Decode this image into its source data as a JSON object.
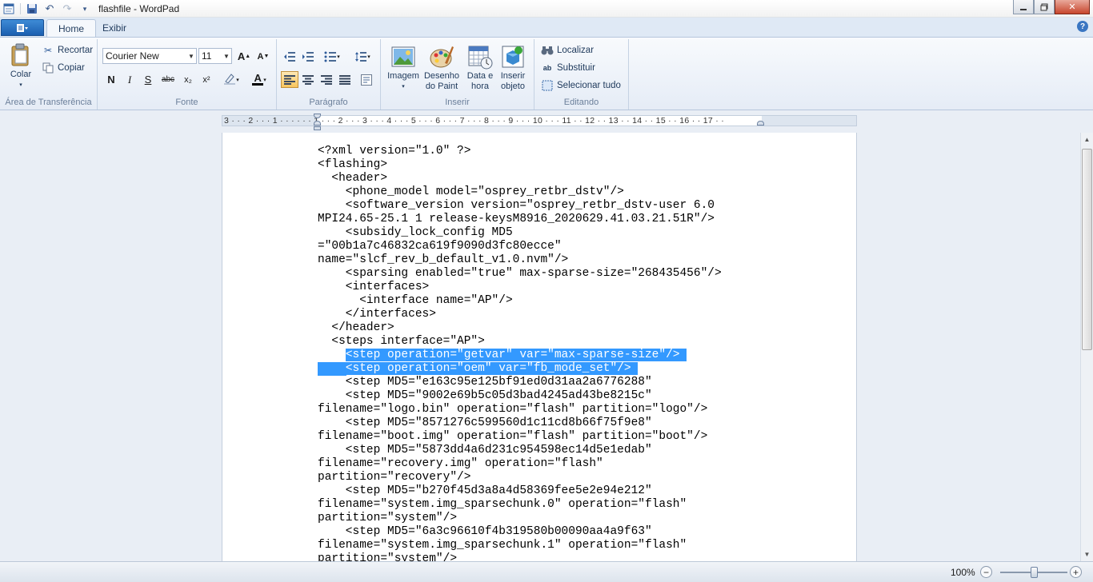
{
  "window": {
    "title": "flashfile - WordPad"
  },
  "tabs": {
    "home": "Home",
    "view": "Exibir"
  },
  "ribbon": {
    "clipboard": {
      "label": "Área de Transferência",
      "paste": "Colar",
      "cut": "Recortar",
      "copy": "Copiar"
    },
    "font": {
      "label": "Fonte",
      "family": "Courier New",
      "size": "11",
      "bold": "N",
      "italic": "I",
      "underline": "S",
      "strike": "abc",
      "subscript": "x₂",
      "superscript": "x²"
    },
    "paragraph": {
      "label": "Parágrafo"
    },
    "insert": {
      "label": "Inserir",
      "image": "Imagem",
      "paint_line1": "Desenho",
      "paint_line2": "do Paint",
      "date_line1": "Data e",
      "date_line2": "hora",
      "object_line1": "Inserir",
      "object_line2": "objeto"
    },
    "editing": {
      "label": "Editando",
      "find": "Localizar",
      "replace": "Substituir",
      "select_all": "Selecionar tudo"
    }
  },
  "ruler": {
    "numbers": "3 · · · 2 · · · 1 · · ·   · · · 1 · · · 2 · · · 3 · · · 4 · · · 5 · · · 6 · · · 7 · · · 8 · · · 9 · · · 10 · · · 11 · · 12 · · 13 · · 14 · · 15 · · 16 · · 17 · ·"
  },
  "document": {
    "lines": [
      "<?xml version=\"1.0\" ?>",
      "<flashing>",
      "  <header>",
      "    <phone_model model=\"osprey_retbr_dstv\"/>",
      "    <software_version version=\"osprey_retbr_dstv-user 6.0",
      "MPI24.65-25.1 1 release-keysM8916_2020629.41.03.21.51R\"/>",
      "    <subsidy_lock_config MD5",
      "=\"00b1a7c46832ca619f9090d3fc80ecce\"",
      "name=\"slcf_rev_b_default_v1.0.nvm\"/>",
      "    <sparsing enabled=\"true\" max-sparse-size=\"268435456\"/>",
      "    <interfaces>",
      "      <interface name=\"AP\"/>",
      "    </interfaces>",
      "  </header>",
      "  <steps interface=\"AP\">",
      "    <step operation=\"getvar\" var=\"max-sparse-size\"/>",
      "    <step operation=\"oem\" var=\"fb_mode_set\"/>",
      "    <step MD5=\"e163c95e125bf91ed0d31aa2a6776288\"",
      "    <step MD5=\"9002e69b5c05d3bad4245ad43be8215c\"",
      "filename=\"logo.bin\" operation=\"flash\" partition=\"logo\"/>",
      "    <step MD5=\"8571276c599560d1c11cd8b66f75f9e8\"",
      "filename=\"boot.img\" operation=\"flash\" partition=\"boot\"/>",
      "    <step MD5=\"5873dd4a6d231c954598ec14d5e1edab\"",
      "filename=\"recovery.img\" operation=\"flash\"",
      "partition=\"recovery\"/>",
      "    <step MD5=\"b270f45d3a8a4d58369fee5e2e94e212\"",
      "filename=\"system.img_sparsechunk.0\" operation=\"flash\"",
      "partition=\"system\"/>",
      "    <step MD5=\"6a3c96610f4b319580b00090aa4a9f63\"",
      "filename=\"system.img_sparsechunk.1\" operation=\"flash\"",
      "partition=\"system\"/>"
    ],
    "highlighted_lines": [
      15,
      16
    ]
  },
  "status": {
    "zoom": "100%",
    "zoom_out": "−",
    "zoom_in": "+"
  }
}
